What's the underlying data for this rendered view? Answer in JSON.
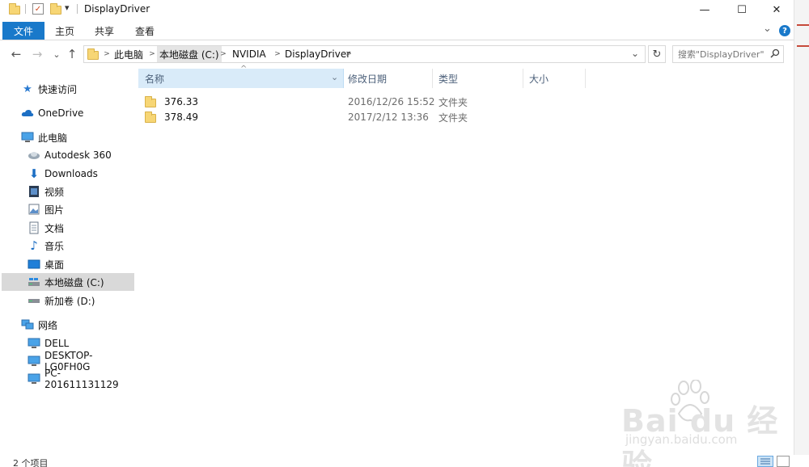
{
  "window": {
    "title": "DisplayDriver",
    "qat_dropdown": "▾",
    "minimize": "—",
    "maximize": "☐",
    "close": "✕"
  },
  "ribbon": {
    "tabs": [
      "文件",
      "主页",
      "共享",
      "查看"
    ],
    "collapse": "⌄",
    "help": "?"
  },
  "nav": {
    "back": "←",
    "forward": "→",
    "recent": "⌄",
    "up": "↑",
    "breadcrumbs": [
      "此电脑",
      "本地磁盘 (C:)",
      "NVIDIA",
      "DisplayDriver"
    ],
    "refresh": "↻",
    "search_placeholder": "搜索\"DisplayDriver\"",
    "address_dropdown": "⌄"
  },
  "sidebar": {
    "items": [
      {
        "label": "快速访问",
        "icon": "star-icon"
      },
      {
        "label": "OneDrive",
        "icon": "cloud-icon"
      },
      {
        "label": "此电脑",
        "icon": "computer-icon"
      },
      {
        "label": "Autodesk 360",
        "icon": "autodesk-icon"
      },
      {
        "label": "Downloads",
        "icon": "download-icon"
      },
      {
        "label": "视频",
        "icon": "video-icon"
      },
      {
        "label": "图片",
        "icon": "pictures-icon"
      },
      {
        "label": "文档",
        "icon": "documents-icon"
      },
      {
        "label": "音乐",
        "icon": "music-icon"
      },
      {
        "label": "桌面",
        "icon": "desktop-icon"
      },
      {
        "label": "本地磁盘 (C:)",
        "icon": "drive-c-icon"
      },
      {
        "label": "新加卷 (D:)",
        "icon": "drive-d-icon"
      },
      {
        "label": "网络",
        "icon": "network-icon"
      },
      {
        "label": "DELL",
        "icon": "pc-icon"
      },
      {
        "label": "DESKTOP-LG0FH0G",
        "icon": "pc-icon"
      },
      {
        "label": "PC-201611131129",
        "icon": "pc-icon"
      }
    ]
  },
  "filelist": {
    "columns": [
      "名称",
      "修改日期",
      "类型",
      "大小"
    ],
    "sort_indicator": "^",
    "rows": [
      {
        "name": "376.33",
        "modified": "2016/12/26 15:52",
        "type": "文件夹"
      },
      {
        "name": "378.49",
        "modified": "2017/2/12 13:36",
        "type": "文件夹"
      }
    ]
  },
  "status": {
    "count": "2 个项目"
  },
  "watermark": {
    "brand": "Bai du 经验",
    "url": "jingyan.baidu.com"
  },
  "colors": {
    "accent": "#1979ca",
    "selected_bg": "#d9d9d9",
    "header_hover": "#d9ebf9",
    "folder": "#f7d675"
  }
}
